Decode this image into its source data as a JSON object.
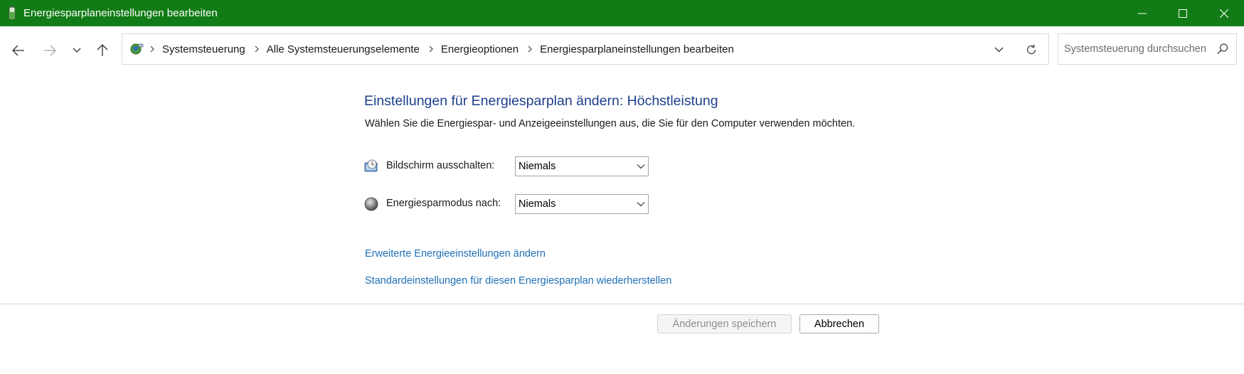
{
  "window": {
    "title": "Energiesparplaneinstellungen bearbeiten"
  },
  "breadcrumbs": [
    "Systemsteuerung",
    "Alle Systemsteuerungselemente",
    "Energieoptionen",
    "Energiesparplaneinstellungen bearbeiten"
  ],
  "search": {
    "placeholder": "Systemsteuerung durchsuchen",
    "value": ""
  },
  "main": {
    "title": "Einstellungen für Energiesparplan ändern: Höchstleistung",
    "description": "Wählen Sie die Energiespar- und Anzeigeeinstellungen aus, die Sie für den Computer verwenden möchten.",
    "settings": [
      {
        "label": "Bildschirm ausschalten:",
        "value": "Niemals",
        "icon": "display-clock-icon"
      },
      {
        "label": "Energiesparmodus nach:",
        "value": "Niemals",
        "icon": "sleep-moon-icon"
      }
    ],
    "links": [
      "Erweiterte Energieeinstellungen ändern",
      "Standardeinstellungen für diesen Energiesparplan wiederherstellen"
    ]
  },
  "buttons": {
    "save": "Änderungen speichern",
    "cancel": "Abbrechen"
  },
  "colors": {
    "titlebar": "#117b15",
    "heading": "#1e3f8a",
    "link": "#1f6fb5"
  }
}
